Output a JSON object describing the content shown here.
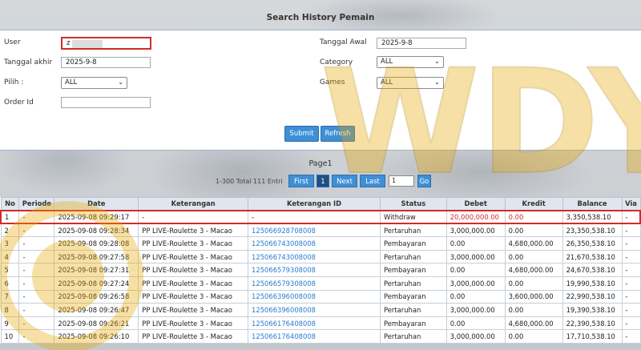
{
  "page_title": "Search History Pemain",
  "form": {
    "user_label": "User",
    "user_value": "z",
    "tanggal_awal_label": "Tanggal Awal",
    "tanggal_awal_value": "2025-9-8",
    "tanggal_akhir_label": "Tanggal akhir",
    "tanggal_akhir_value": "2025-9-8",
    "category_label": "Category",
    "category_value": "ALL",
    "pilih_label": "Pilih  :",
    "pilih_value": "ALL",
    "games_label": "Games",
    "games_value": "ALL",
    "order_id_label": "Order Id",
    "order_id_value": "",
    "submit_label": "Submit",
    "refresh_label": "Refresh"
  },
  "pagination": {
    "page_label": "Page1",
    "info": "1-300 Total 111 Entri",
    "first": "First",
    "current": "1",
    "next": "Next",
    "last": "Last",
    "page_input": "1",
    "go": "Go"
  },
  "table": {
    "headers": [
      "No",
      "Periode",
      "Date",
      "Keterangan",
      "Keterangan ID",
      "Status",
      "Debet",
      "Kredit",
      "Balance",
      "Via"
    ],
    "rows": [
      [
        "1",
        "-",
        "2025-09-08 09:29:17",
        "-",
        "-",
        "Withdraw",
        "20,000,000.00",
        "0.00",
        "3,350,538.10",
        "-"
      ],
      [
        "2",
        "-",
        "2025-09-08 09:28:34",
        "PP LIVE-Roulette 3 - Macao",
        "125066928708008",
        "Pertaruhan",
        "3,000,000.00",
        "0.00",
        "23,350,538.10",
        "-"
      ],
      [
        "3",
        "-",
        "2025-09-08 09:28:08",
        "PP LIVE-Roulette 3 - Macao",
        "125066743008008",
        "Pembayaran",
        "0.00",
        "4,680,000.00",
        "26,350,538.10",
        "-"
      ],
      [
        "4",
        "-",
        "2025-09-08 09:27:58",
        "PP LIVE-Roulette 3 - Macao",
        "125066743008008",
        "Pertaruhan",
        "3,000,000.00",
        "0.00",
        "21,670,538.10",
        "-"
      ],
      [
        "5",
        "-",
        "2025-09-08 09:27:31",
        "PP LIVE-Roulette 3 - Macao",
        "125066579308008",
        "Pembayaran",
        "0.00",
        "4,680,000.00",
        "24,670,538.10",
        "-"
      ],
      [
        "6",
        "-",
        "2025-09-08 09:27:24",
        "PP LIVE-Roulette 3 - Macao",
        "125066579308008",
        "Pertaruhan",
        "3,000,000.00",
        "0.00",
        "19,990,538.10",
        "-"
      ],
      [
        "7",
        "-",
        "2025-09-08 09:26:58",
        "PP LIVE-Roulette 3 - Macao",
        "125066396008008",
        "Pembayaran",
        "0.00",
        "3,600,000.00",
        "22,990,538.10",
        "-"
      ],
      [
        "8",
        "-",
        "2025-09-08 09:26:47",
        "PP LIVE-Roulette 3 - Macao",
        "125066396008008",
        "Pertaruhan",
        "3,000,000.00",
        "0.00",
        "19,390,538.10",
        "-"
      ],
      [
        "9",
        "-",
        "2025-09-08 09:26:21",
        "PP LIVE-Roulette 3 - Macao",
        "125066176408008",
        "Pembayaran",
        "0.00",
        "4,680,000.00",
        "22,390,538.10",
        "-"
      ],
      [
        "10",
        "-",
        "2025-09-08 09:26:10",
        "PP LIVE-Roulette 3 - Macao",
        "125066176408008",
        "Pertaruhan",
        "3,000,000.00",
        "0.00",
        "17,710,538.10",
        "-"
      ]
    ]
  },
  "colors": {
    "accent": "#3e8fd6",
    "highlight": "#d42a2a",
    "link": "#2b7bd0",
    "watermark": "#e8a800"
  },
  "watermark_text": "WDYUK"
}
